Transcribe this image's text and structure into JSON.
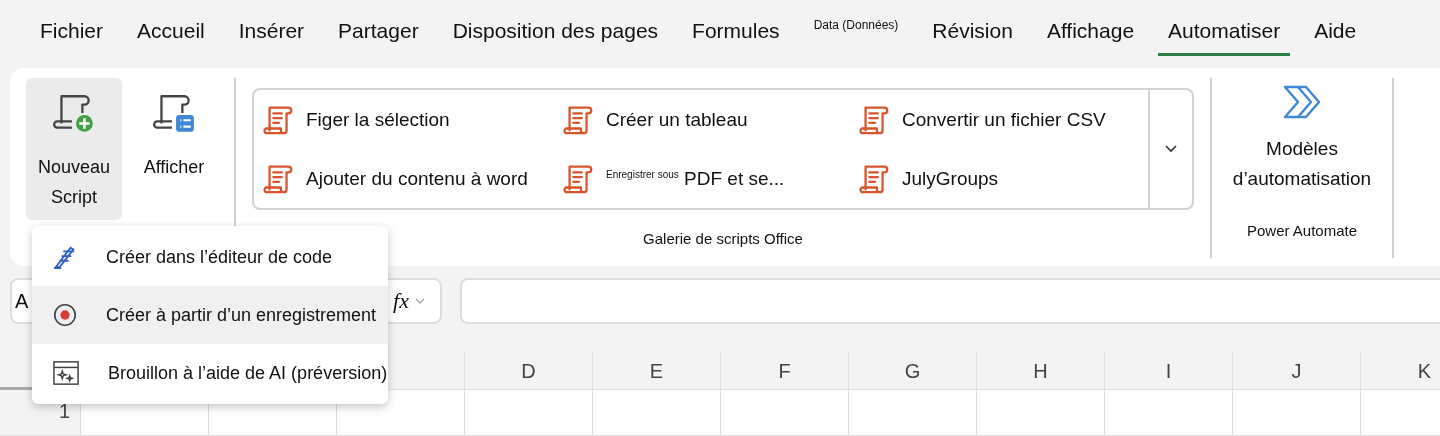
{
  "tabs": [
    {
      "label": "Fichier",
      "kind": "normal",
      "selected": false
    },
    {
      "label": "Accueil",
      "kind": "normal",
      "selected": false
    },
    {
      "label": "Insérer",
      "kind": "normal",
      "selected": false
    },
    {
      "label": "Partager",
      "kind": "normal",
      "selected": false
    },
    {
      "label": "Disposition des pages",
      "kind": "normal",
      "selected": false
    },
    {
      "label": "Formules",
      "kind": "normal",
      "selected": false
    },
    {
      "label": "Data (Données)",
      "kind": "small",
      "selected": false
    },
    {
      "label": "Révision",
      "kind": "normal",
      "selected": false
    },
    {
      "label": "Affichage",
      "kind": "normal",
      "selected": false
    },
    {
      "label": "Automatiser",
      "kind": "normal",
      "selected": true
    },
    {
      "label": "Aide",
      "kind": "normal",
      "selected": false
    }
  ],
  "ribbon": {
    "script_buttons": [
      {
        "label": "Nouveau Script",
        "kind": "new",
        "selected": true
      },
      {
        "label": "Afficher",
        "kind": "view",
        "selected": false
      }
    ],
    "gallery": {
      "items": [
        "Figer la sélection",
        "Créer un tableau",
        "Convertir un fichier CSV",
        "Ajouter du contenu à word",
        "$^{Enregistrer sous}$ PDF et se...",
        "JulyGroups"
      ],
      "group_label": "Galerie de scripts Office"
    },
    "power_automate": {
      "button": "Modèles d’automatisation",
      "group_label": "Power Automate"
    }
  },
  "formula_bar": {
    "name_box": "A",
    "function_label": "fx"
  },
  "menu": [
    {
      "label": "Créer dans l’éditeur de code",
      "kind": "code",
      "selected": false
    },
    {
      "label": "Créer à partir d’un enregistrement",
      "kind": "record",
      "selected": true
    },
    {
      "label": "Brouillon à l’aide de AI (préversion)",
      "kind": "ai",
      "selected": false
    }
  ],
  "grid": {
    "columns": [
      "D",
      "E",
      "F",
      "G",
      "H",
      "I",
      "J",
      "K"
    ],
    "rows": [
      "1"
    ]
  }
}
